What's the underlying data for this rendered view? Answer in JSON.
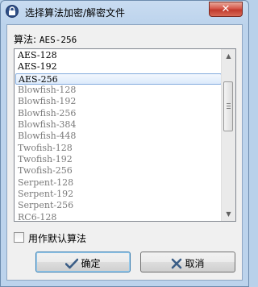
{
  "window": {
    "title": "选择算法加密/解密文件",
    "close_label": "✕"
  },
  "algorithm": {
    "label": "算法:",
    "value": "AES-256"
  },
  "list": {
    "items": [
      {
        "label": "AES-128",
        "style": "dark"
      },
      {
        "label": "AES-192",
        "style": "dark"
      },
      {
        "label": "AES-256",
        "style": "selected"
      },
      {
        "label": "Blowfish-128",
        "style": "gray"
      },
      {
        "label": "Blowfish-192",
        "style": "gray"
      },
      {
        "label": "Blowfish-256",
        "style": "gray"
      },
      {
        "label": "Blowfish-384",
        "style": "gray"
      },
      {
        "label": "Blowfish-448",
        "style": "gray"
      },
      {
        "label": "Twofish-128",
        "style": "gray"
      },
      {
        "label": "Twofish-192",
        "style": "gray"
      },
      {
        "label": "Twofish-256",
        "style": "gray"
      },
      {
        "label": "Serpent-128",
        "style": "gray"
      },
      {
        "label": "Serpent-192",
        "style": "gray"
      },
      {
        "label": "Serpent-256",
        "style": "gray"
      },
      {
        "label": "RC6-128",
        "style": "gray"
      }
    ]
  },
  "default_checkbox": {
    "label": "用作默认算法",
    "checked": false
  },
  "buttons": {
    "ok_label": "确定",
    "cancel_label": "取消"
  },
  "colors": {
    "accent": "#3c7fb1",
    "selection_border": "#84acdd",
    "close": "#c13a2c"
  },
  "icons": {
    "title": "lock-icon",
    "ok": "checkmark-icon",
    "cancel": "x-icon"
  }
}
